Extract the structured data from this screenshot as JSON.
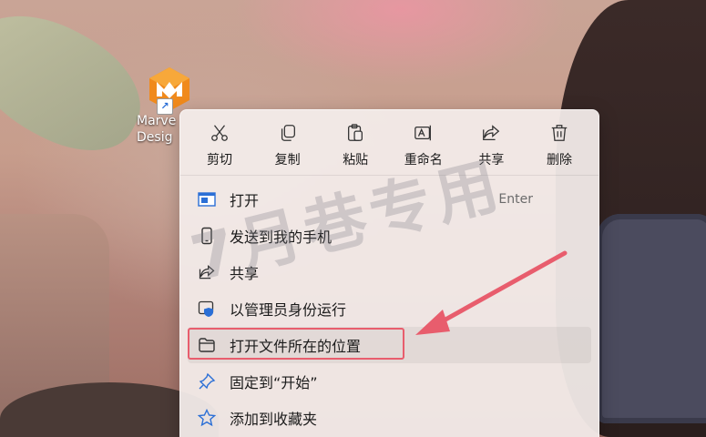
{
  "desktop_icon": {
    "label_line1": "Marve",
    "label_line2": "Desig"
  },
  "toolbar": [
    {
      "label": "剪切",
      "icon": "cut-icon"
    },
    {
      "label": "复制",
      "icon": "copy-icon"
    },
    {
      "label": "粘贴",
      "icon": "paste-icon"
    },
    {
      "label": "重命名",
      "icon": "rename-icon"
    },
    {
      "label": "共享",
      "icon": "share-icon"
    },
    {
      "label": "删除",
      "icon": "delete-icon"
    }
  ],
  "menu_items": [
    {
      "label": "打开",
      "shortcut": "Enter",
      "icon": "open-app-icon"
    },
    {
      "label": "发送到我的手机",
      "icon": "phone-icon"
    },
    {
      "label": "共享",
      "icon": "share-icon"
    },
    {
      "label": "以管理员身份运行",
      "icon": "shield-icon"
    },
    {
      "label": "打开文件所在的位置",
      "icon": "folder-icon"
    },
    {
      "label": "固定到“开始”",
      "icon": "pin-icon"
    },
    {
      "label": "添加到收藏夹",
      "icon": "star-icon"
    }
  ],
  "watermark": "7月巷专用",
  "colors": {
    "accent": "#2b6fd6",
    "annotation": "#e85d6d"
  }
}
